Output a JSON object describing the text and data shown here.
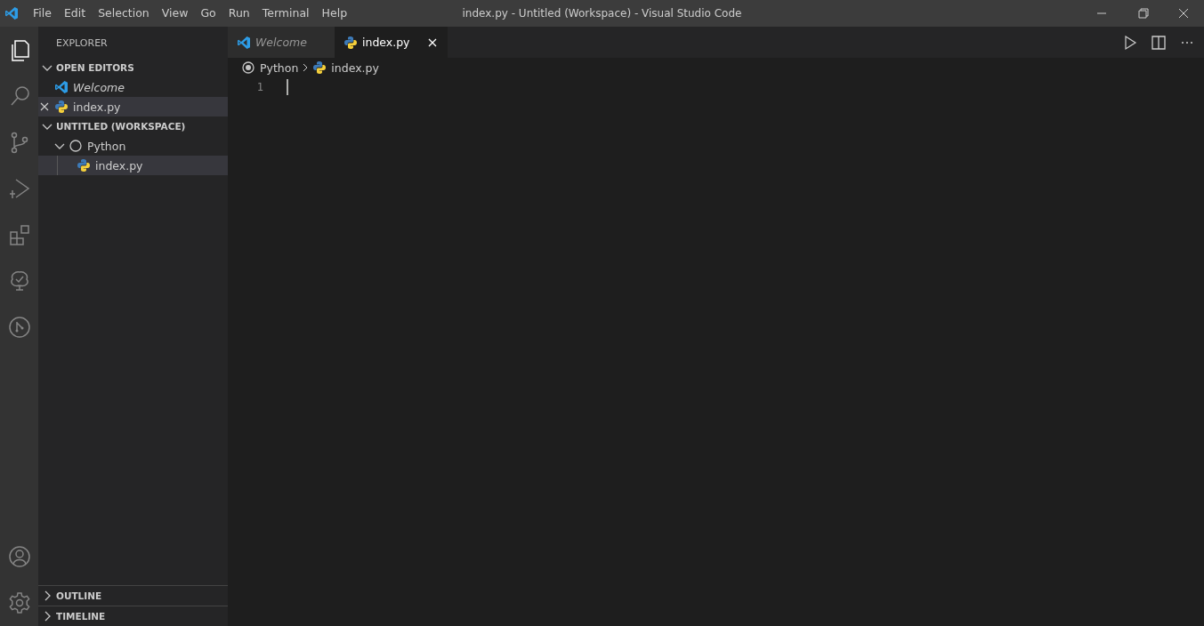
{
  "window": {
    "title": "index.py - Untitled (Workspace) - Visual Studio Code"
  },
  "menu_bar": [
    "File",
    "Edit",
    "Selection",
    "View",
    "Go",
    "Run",
    "Terminal",
    "Help"
  ],
  "activity_bar": [
    {
      "kind": "files",
      "selected": true
    },
    {
      "kind": "search",
      "selected": false
    },
    {
      "kind": "source-control",
      "selected": false
    },
    {
      "kind": "run",
      "selected": false
    },
    {
      "kind": "extensions",
      "selected": false
    },
    {
      "kind": "tree",
      "selected": false
    },
    {
      "kind": "branch",
      "selected": false
    }
  ],
  "activity_bar_bottom": [
    {
      "kind": "account"
    },
    {
      "kind": "settings"
    }
  ],
  "sidebar": {
    "title": "EXPLORER",
    "sections": [
      {
        "title": "OPEN EDITORS",
        "expanded": true,
        "items": [
          {
            "label": "Welcome",
            "kind": "vscode",
            "preview": true,
            "selected": false,
            "close": false
          },
          {
            "label": "index.py",
            "kind": "python",
            "preview": false,
            "selected": true,
            "close": true
          }
        ]
      },
      {
        "title": "UNTITLED (WORKSPACE)",
        "expanded": true,
        "tree": [
          {
            "label": "Python",
            "kind": "root",
            "expanded": true,
            "selected": false,
            "children": [
              {
                "label": "index.py",
                "kind": "python",
                "selected": true
              }
            ]
          }
        ]
      }
    ],
    "bottom_sections": [
      {
        "title": "OUTLINE",
        "expanded": false
      },
      {
        "title": "TIMELINE",
        "expanded": false
      }
    ]
  },
  "tabs": [
    {
      "label": "Welcome",
      "kind": "vscode",
      "preview": true,
      "selected": false
    },
    {
      "label": "index.py",
      "kind": "python",
      "preview": false,
      "selected": true
    }
  ],
  "breadcrumbs": [
    {
      "label": "Python",
      "kind": "root"
    },
    {
      "label": "index.py",
      "kind": "python"
    }
  ],
  "editor": {
    "line_numbers": [
      "1"
    ]
  }
}
